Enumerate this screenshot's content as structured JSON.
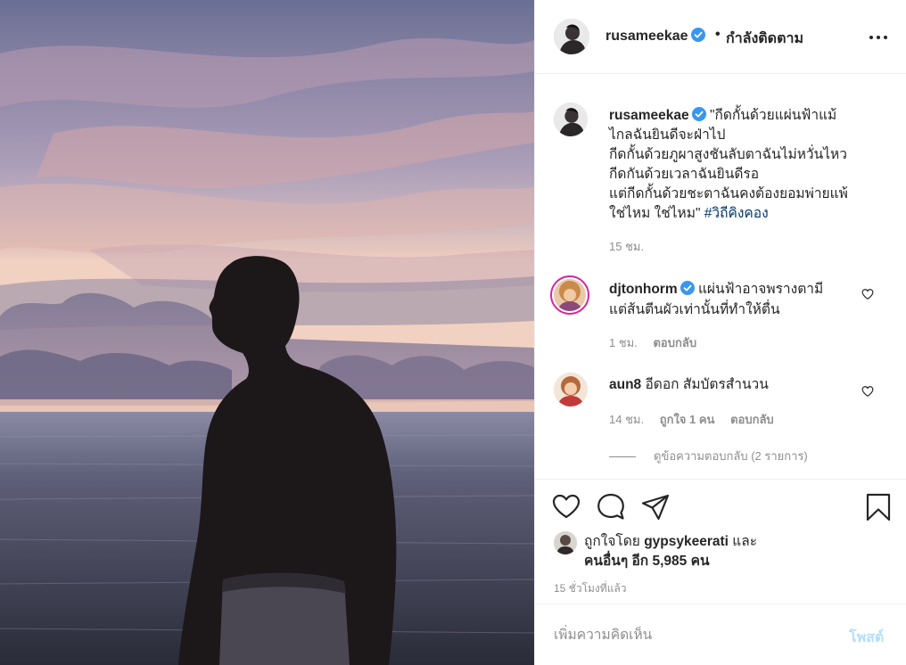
{
  "post": {
    "author": "rusameekae",
    "follow_status": "กำลังติดตาม",
    "header_dot": "•",
    "caption_lines": [
      "\"กีดกั้นด้วยแผ่นฟ้าแม้",
      "ไกลฉันยินดีจะฝ่าไป",
      "กีดกั้นด้วยภูผาสูงชันลับตาฉันไม่หวั่นไหว",
      "กีดกันด้วยเวลาฉันยินดีรอ",
      "แต่กีดกั้นด้วยชะตาฉันคงต้องยอมพ่ายแพ้",
      "ใช่ไหม ใช่ไหม\" "
    ],
    "hashtag": "#วิถีคิงคอง",
    "caption_time": "15 ชม."
  },
  "comments": [
    {
      "user": "djtonhorm",
      "text_lines": [
        "แผ่นฟ้าอาจพรางตามี",
        "แต่ส้นตีนผัวเท่านั้นที่ทำให้ตื่น"
      ],
      "time": "1 ชม.",
      "reply": "ตอบกลับ"
    },
    {
      "user": "aun8",
      "text": "อีดอก สัมบัตรสำนวน",
      "time": "14 ชม.",
      "likes": "ถูกใจ 1 คน",
      "reply": "ตอบกลับ",
      "view_replies": "ดูข้อความตอบกลับ (2 รายการ)"
    }
  ],
  "likes": {
    "prefix": "ถูกใจโดย ",
    "user": "gypsykeerati",
    "and": " และ",
    "others": "คนอื่นๆ อีก 5,985 คน"
  },
  "post_time": "15 ชั่วโมงที่แล้ว",
  "comment_box": {
    "placeholder": "เพิ่มความคิดเห็น",
    "post_label": "โพสต์"
  },
  "colors": {
    "verified": "#3897f0",
    "hashtag": "#00376b",
    "muted": "#8e8e8e",
    "post_disabled": "#b2dffc"
  },
  "icons": [
    "verified-badge-icon",
    "more-options-icon",
    "heart-icon",
    "comment-icon",
    "share-icon",
    "bookmark-icon"
  ]
}
